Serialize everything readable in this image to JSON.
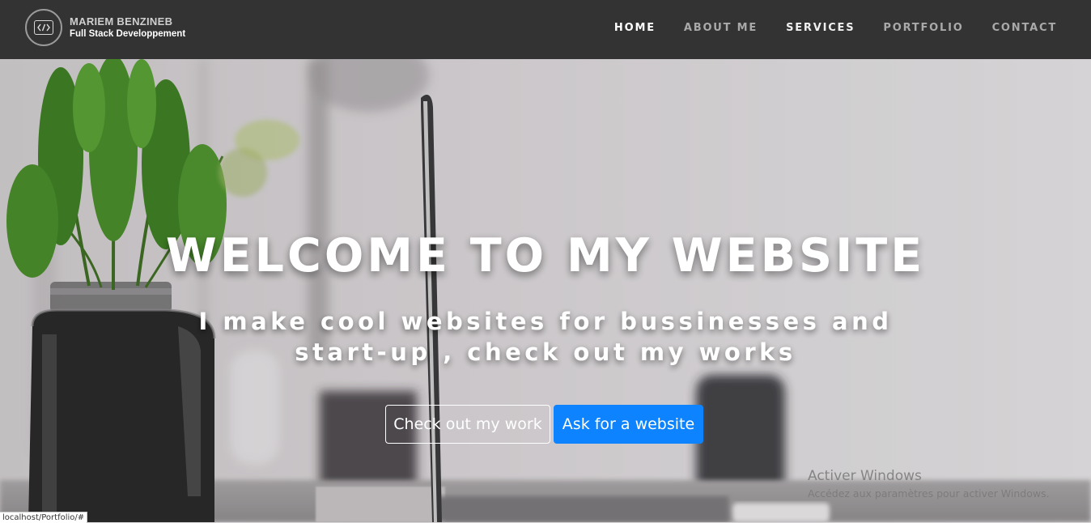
{
  "navbar": {
    "brand_name": "MARIEM BENZINEB",
    "brand_subtitle": "Full Stack Developpement",
    "logo_icon": "code-brackets-icon",
    "links": [
      {
        "label": "HOME",
        "active": true
      },
      {
        "label": "ABOUT ME",
        "active": false
      },
      {
        "label": "SERVICES",
        "active": false
      },
      {
        "label": "PORTFOLIO",
        "active": false
      },
      {
        "label": "CONTACT",
        "active": false
      }
    ]
  },
  "hero": {
    "title": "WELCOME TO MY WEBSITE",
    "subtitle": "I make cool websites for bussinesses and start-up , check out my works",
    "buttons": {
      "secondary_label": "Check out my work",
      "primary_label": "Ask for a website"
    }
  },
  "windows_watermark": {
    "title": "Activer Windows",
    "subtitle": "Accédez aux paramètres pour activer Windows."
  },
  "status_bar": {
    "url": "localhost/Portfolio/#"
  },
  "colors": {
    "navbar_bg": "#333333",
    "primary_button": "#0d83ff",
    "text_light": "#ffffff"
  }
}
